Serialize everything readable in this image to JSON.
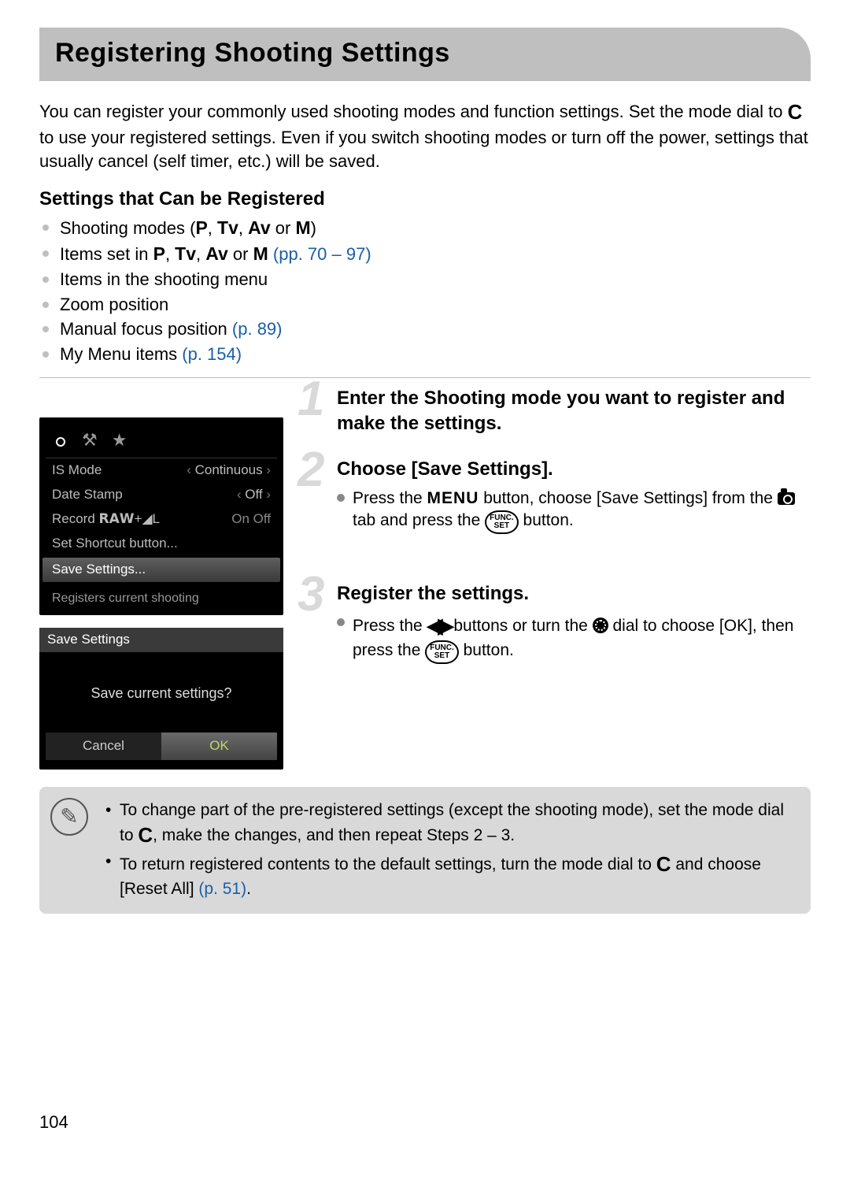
{
  "title": "Registering Shooting Settings",
  "intro": {
    "p1a": "You can register your commonly used shooting modes and function settings. Set the mode dial to ",
    "p1b": " to use your registered settings. Even if you switch shooting modes or turn off the power, settings that usually cancel (self timer, etc.) will be saved."
  },
  "settings_head": "Settings that Can be Registered",
  "list": {
    "i1a": "Shooting modes (",
    "i1b": ")",
    "i2a": "Items set in ",
    "i2ref": "(pp. 70 – 97)",
    "i3": "Items in the shooting menu",
    "i4": "Zoom position",
    "i5a": "Manual focus position ",
    "i5ref": "(p. 89)",
    "i6a": "My Menu items ",
    "i6ref": "(p. 154)"
  },
  "modes": {
    "P": "P",
    "Tv": "Tv",
    "Av": "Av",
    "M": "M",
    "or": " or ",
    "comma": ", "
  },
  "c_icon": "C",
  "lcd1": {
    "tab_tools": "⚒",
    "tab_star": "★",
    "rows": [
      {
        "k": "IS Mode",
        "v": "Continuous"
      },
      {
        "k": "Date Stamp",
        "v": "Off"
      },
      {
        "k": "Record 𝗥𝗔𝗪+◢L",
        "v": "On   Off"
      },
      {
        "k": "Set Shortcut button...",
        "v": ""
      },
      {
        "k": "Save Settings...",
        "v": ""
      }
    ],
    "hint": "Registers current shooting"
  },
  "lcd2": {
    "hdr": "Save Settings",
    "q": "Save current settings?",
    "cancel": "Cancel",
    "ok": "OK"
  },
  "steps": {
    "s1": {
      "n": "1",
      "h": "Enter the Shooting mode you want to register and make the settings."
    },
    "s2": {
      "n": "2",
      "h": "Choose [Save Settings].",
      "b1a": "Press the ",
      "menu": "MENU",
      "b1b": " button, choose [Save Settings] from the ",
      "b1c": " tab and press the ",
      "b1d": " button."
    },
    "s3": {
      "n": "3",
      "h": "Register the settings.",
      "b1a": "Press the ",
      "b1b": " buttons or turn the ",
      "b1c": " dial to choose [OK], then press the ",
      "b1d": " button."
    }
  },
  "func": "FUNC.\nSET",
  "note": {
    "n1a": "To change part of the pre-registered settings (except the shooting mode), set the mode dial to ",
    "n1b": ", make the changes, and then repeat Steps 2 – 3.",
    "n2a": "To return registered contents to the default settings, turn the mode dial to ",
    "n2b": " and choose [Reset All] ",
    "n2ref": "(p. 51)",
    "n2c": "."
  },
  "page_number": "104"
}
